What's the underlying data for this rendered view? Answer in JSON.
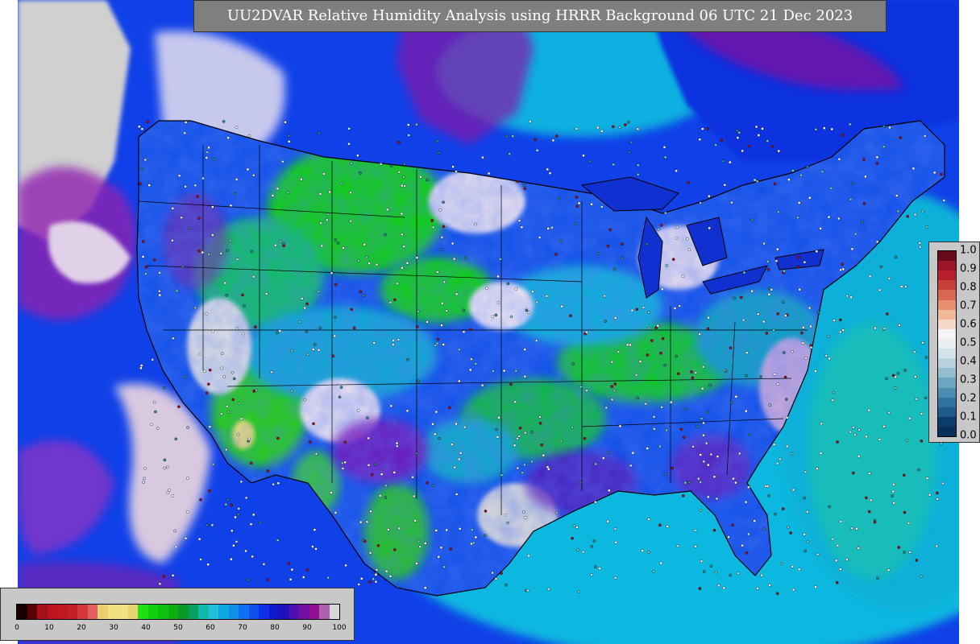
{
  "title": "UU2DVAR Relative Humidity Analysis using HRRR Background 06 UTC 21 Dec 2023",
  "legend_horizontal": {
    "ticks": [
      "0",
      "10",
      "20",
      "30",
      "40",
      "50",
      "60",
      "70",
      "80",
      "90",
      "100"
    ],
    "colors": [
      "#1a0000",
      "#5c0008",
      "#a3101a",
      "#c0141f",
      "#c01822",
      "#c31e25",
      "#d23a3a",
      "#e06060",
      "#e8d070",
      "#f0e080",
      "#f0e080",
      "#e8d470",
      "#20e010",
      "#10d010",
      "#10c010",
      "#0cb00c",
      "#0a9a2a",
      "#08a060",
      "#10b8b0",
      "#20c0d8",
      "#10a8e0",
      "#1090e8",
      "#1070f0",
      "#1050f0",
      "#1030e8",
      "#1018d0",
      "#2010c0",
      "#5010b0",
      "#7010a0",
      "#901090",
      "#b060b0",
      "#d8d8d8"
    ]
  },
  "legend_vertical": {
    "ticks": [
      "1.0",
      "0.9",
      "0.8",
      "0.7",
      "0.6",
      "0.5",
      "0.4",
      "0.3",
      "0.2",
      "0.1",
      "0.0"
    ],
    "colors": [
      "#670a1c",
      "#9a1626",
      "#b8202e",
      "#c8403c",
      "#d86650",
      "#e69070",
      "#f2b89a",
      "#f6d8c8",
      "#f4f4f4",
      "#e8eef2",
      "#d4e2ea",
      "#b8d2de",
      "#92bece",
      "#6aa6c0",
      "#4c8cb0",
      "#3072a0",
      "#1e5a8a",
      "#0c3c6c",
      "#08305a"
    ]
  },
  "map_colors": {
    "ocean_blue": "#1040e8",
    "cyan": "#10b8e0",
    "teal": "#10a0c0",
    "green": "#10d010",
    "dark_green": "#0a9a30",
    "purple": "#8010a0",
    "magenta_white": "#f0e0f0",
    "gray": "#d0d0d0",
    "yellow": "#f0e070",
    "navy": "#1018b8"
  }
}
